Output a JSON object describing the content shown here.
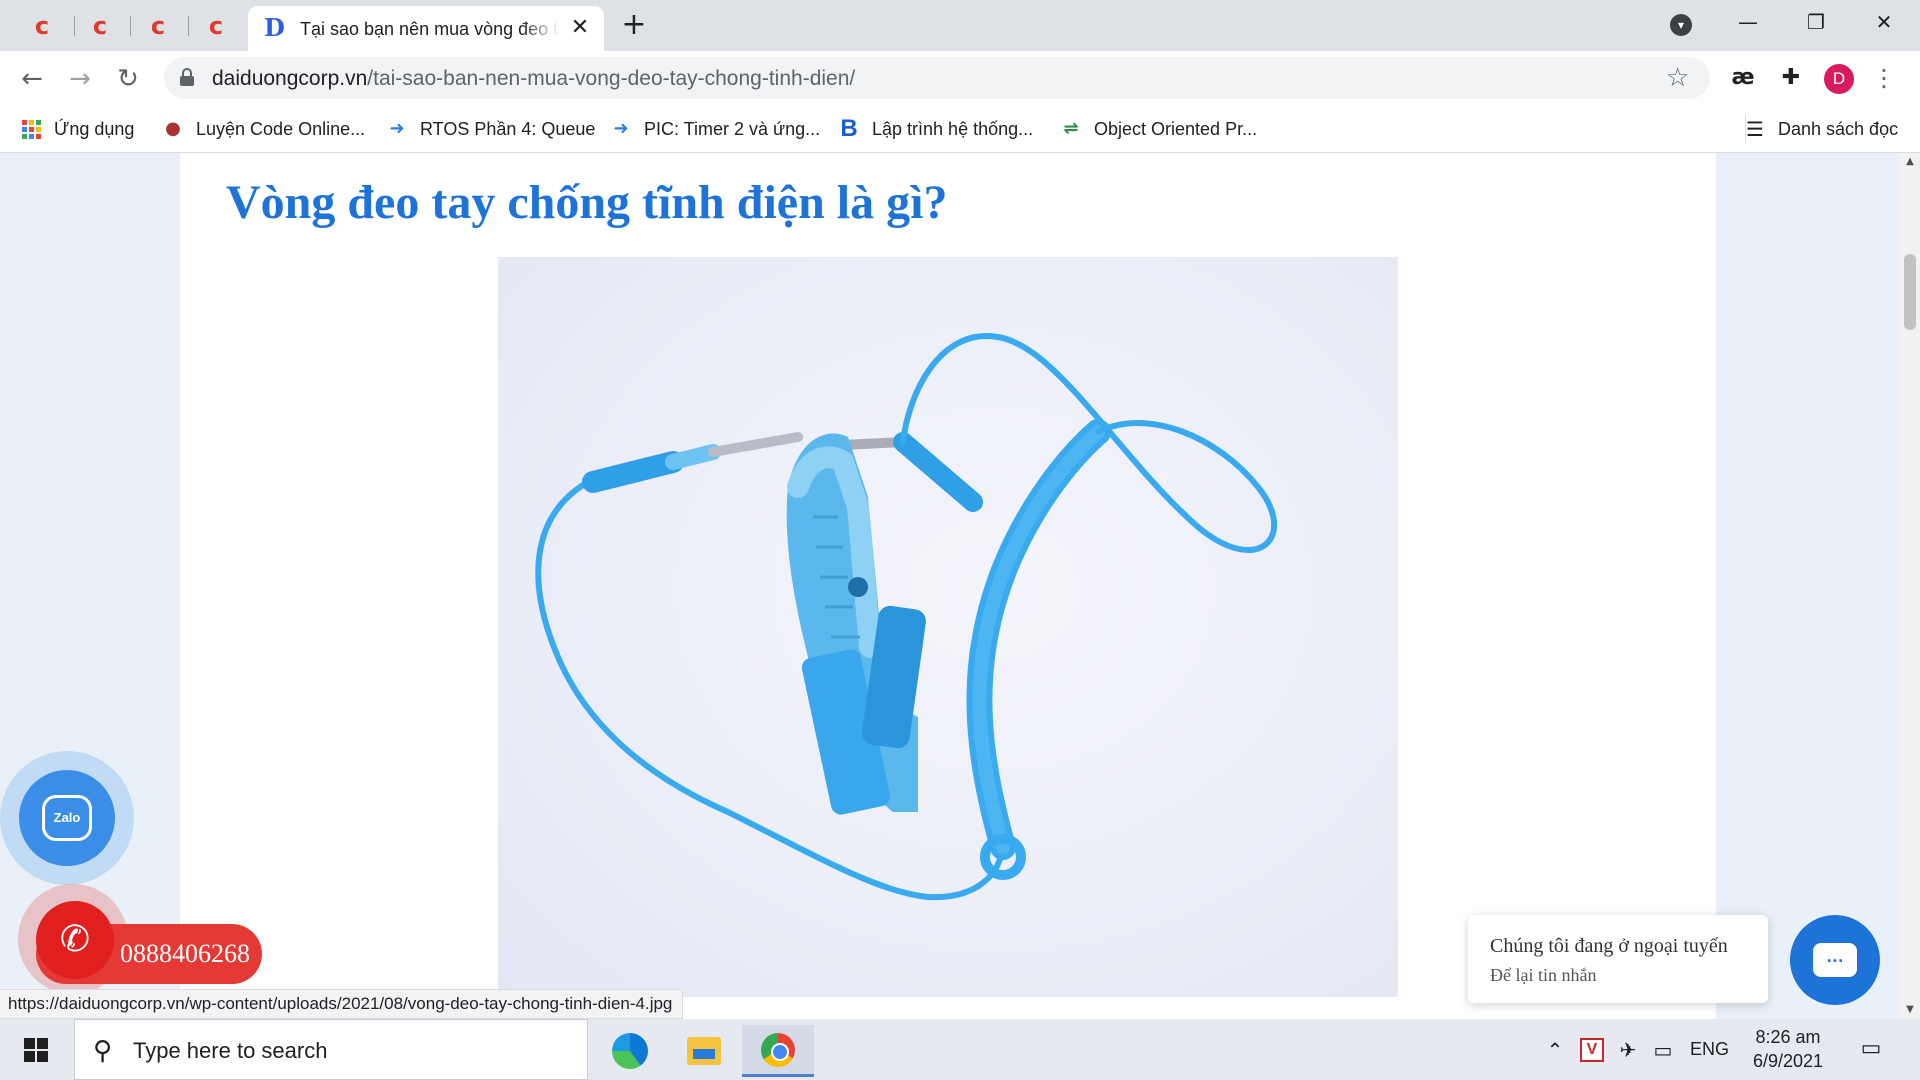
{
  "browser": {
    "pinned_tabs": [
      {
        "icon": "c-logo-icon",
        "glyph": "c"
      },
      {
        "icon": "c-logo-icon",
        "glyph": "c"
      },
      {
        "icon": "c-logo-icon",
        "glyph": "c"
      },
      {
        "icon": "c-logo-icon",
        "glyph": "c"
      }
    ],
    "active_tab": {
      "favicon": "D",
      "title": "Tại sao bạn nên mua vòng đeo tay chống tĩnh điện",
      "close": "✕"
    },
    "new_tab": "+",
    "window_controls": {
      "minimize": "—",
      "restore": "❐",
      "close": "✕"
    },
    "toolbar": {
      "back": "←",
      "forward": "→",
      "reload": "↻",
      "url_host": "daiduongcorp.vn",
      "url_path": "/tai-sao-ban-nen-mua-vong-deo-tay-chong-tinh-dien/",
      "star": "☆",
      "ext_ae": "æ",
      "ext_puzzle": "✚",
      "avatar_letter": "D",
      "menu": "⋮"
    },
    "bookmarks": [
      {
        "label": "Ứng dụng",
        "icon": "apps-grid-icon"
      },
      {
        "label": "Luyện Code Online...",
        "icon": "user-avatar-icon"
      },
      {
        "label": "RTOS Phần 4: Queue",
        "icon": "code-arrow-icon"
      },
      {
        "label": "PIC: Timer 2 và ứng...",
        "icon": "code-arrow-icon"
      },
      {
        "label": "Lập trình hệ thống...",
        "icon": "b-logo-icon"
      },
      {
        "label": "Object Oriented Pr...",
        "icon": "gfg-logo-icon"
      }
    ],
    "reading_list": "Danh sách đọc",
    "status_url": "https://daiduongcorp.vn/wp-content/uploads/2021/08/vong-deo-tay-chong-tinh-dien-4.jpg"
  },
  "page": {
    "heading": "Vòng đeo tay chống tĩnh điện là gì?",
    "image_alt": "anti-static wrist strap",
    "zalo_label": "Zalo",
    "phone_number": "0888406268",
    "chat": {
      "line1": "Chúng tôi đang ở ngoại tuyến",
      "line2": "Để lại tin nhắn"
    }
  },
  "taskbar": {
    "search_placeholder": "Type here to search",
    "apps": [
      "edge-icon",
      "file-explorer-icon",
      "chrome-icon"
    ],
    "language": "ENG",
    "time": "8:26 am",
    "date": "6/9/2021"
  },
  "colors": {
    "heading": "#1e73d8",
    "wrist_strap": "#3aaaf0",
    "phone_red": "#e53935",
    "chat_blue": "#1e73d8",
    "zalo_blue": "#3a8ee8"
  }
}
